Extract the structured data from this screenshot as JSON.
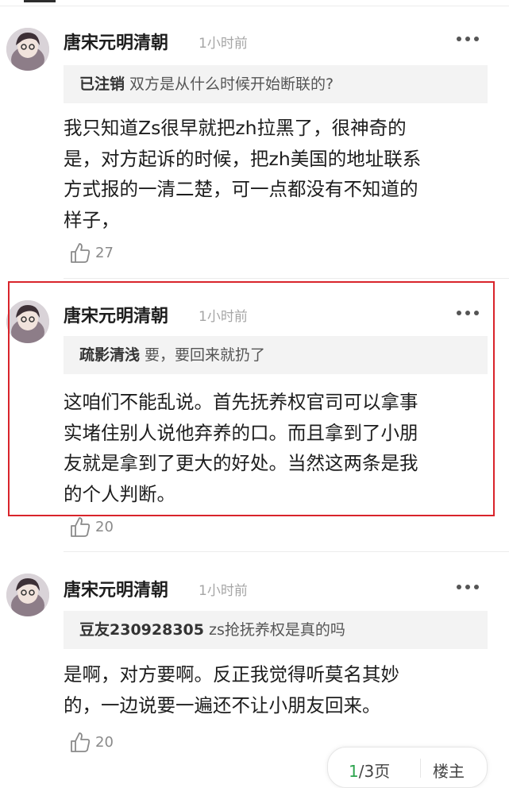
{
  "comments": [
    {
      "author": "唐宋元明清朝",
      "time": "1小时前",
      "quote_author": "已注销",
      "quote_text": "双方是从什么时候开始断联的?",
      "body_lines": [
        "我只知道Zs很早就把zh拉黑了，很神奇的",
        "是，对方起诉的时候，把zh美国的地址联系",
        "方式报的一清二楚，可一点都没有不知道的",
        "样子，"
      ],
      "likes": "27"
    },
    {
      "author": "唐宋元明清朝",
      "time": "1小时前",
      "quote_author": "疏影清浅",
      "quote_text": "要，要回来就扔了",
      "body_lines": [
        "这咱们不能乱说。首先抚养权官司可以拿事",
        "实堵住别人说他弃养的口。而且拿到了小朋",
        "友就是拿到了更大的好处。当然这两条是我",
        "的个人判断。"
      ],
      "likes": "20"
    },
    {
      "author": "唐宋元明清朝",
      "time": "1小时前",
      "quote_author": "豆友230928305",
      "quote_text": "zs抢抚养权是真的吗",
      "body_lines": [
        "是啊，对方要啊。反正我觉得听莫名其妙",
        "的，一边说要一遍还不让小朋友回来。"
      ],
      "likes": "20"
    }
  ],
  "pager": {
    "current": "1",
    "total": "/3页",
    "owner_label": "楼主"
  },
  "colors": {
    "highlight_border": "#d9242b",
    "page_current": "#2da44e"
  },
  "icons": {
    "more": "more-dots-icon",
    "like": "thumbs-up-icon"
  }
}
